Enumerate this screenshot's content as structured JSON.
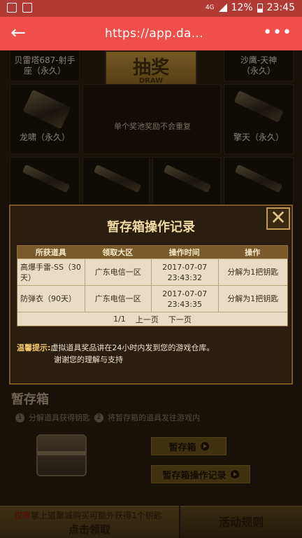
{
  "status_bar": {
    "network": "4G",
    "battery": "12%",
    "time": "23:45"
  },
  "app_bar": {
    "url": "https://app.da..."
  },
  "background": {
    "grid_items": [
      {
        "label": "贝雷塔687-射手\n座（永久）"
      },
      {
        "label": "沙鹰-天神\n（永久）"
      },
      {
        "label": "龙啸（永久）"
      },
      {
        "label": "擎天（永久）"
      }
    ],
    "draw": {
      "title": "抽奖",
      "en": "DRAW",
      "note": "单个奖池奖励不会重复"
    },
    "section": {
      "title": "暂存箱",
      "step1_num": "1",
      "step1": "分解道具获得钥匙",
      "step2_num": "2",
      "step2": "将暂存箱的道具发往游戏内"
    },
    "buttons": {
      "storage": "暂存箱",
      "storage_log": "暂存箱操作记录"
    },
    "bottom": {
      "note_highlight": "仅限",
      "note": "掌上道聚城购买可额外获得1个钥匙",
      "claim": "点击领取",
      "rules": "活动规则"
    }
  },
  "modal": {
    "title": "暂存箱操作记录",
    "close_glyph": "✕",
    "columns": [
      "所获道具",
      "领取大区",
      "操作时间",
      "操作"
    ],
    "rows": [
      {
        "item": "高爆手雷-SS（30天）",
        "region": "广东电信一区",
        "time": "2017-07-07 23:43:32",
        "action": "分解为1把钥匙"
      },
      {
        "item": "防弹衣（90天）",
        "region": "广东电信一区",
        "time": "2017-07-07 23:43:35",
        "action": "分解为1把钥匙"
      }
    ],
    "pager": {
      "page": "1/1",
      "prev": "上一页",
      "next": "下一页"
    },
    "tip_label": "温馨提示:",
    "tip_line1": "虚拟道具奖品讲在24小时内发到您的游戏仓库。",
    "tip_line2": "谢谢您的理解与支持"
  }
}
